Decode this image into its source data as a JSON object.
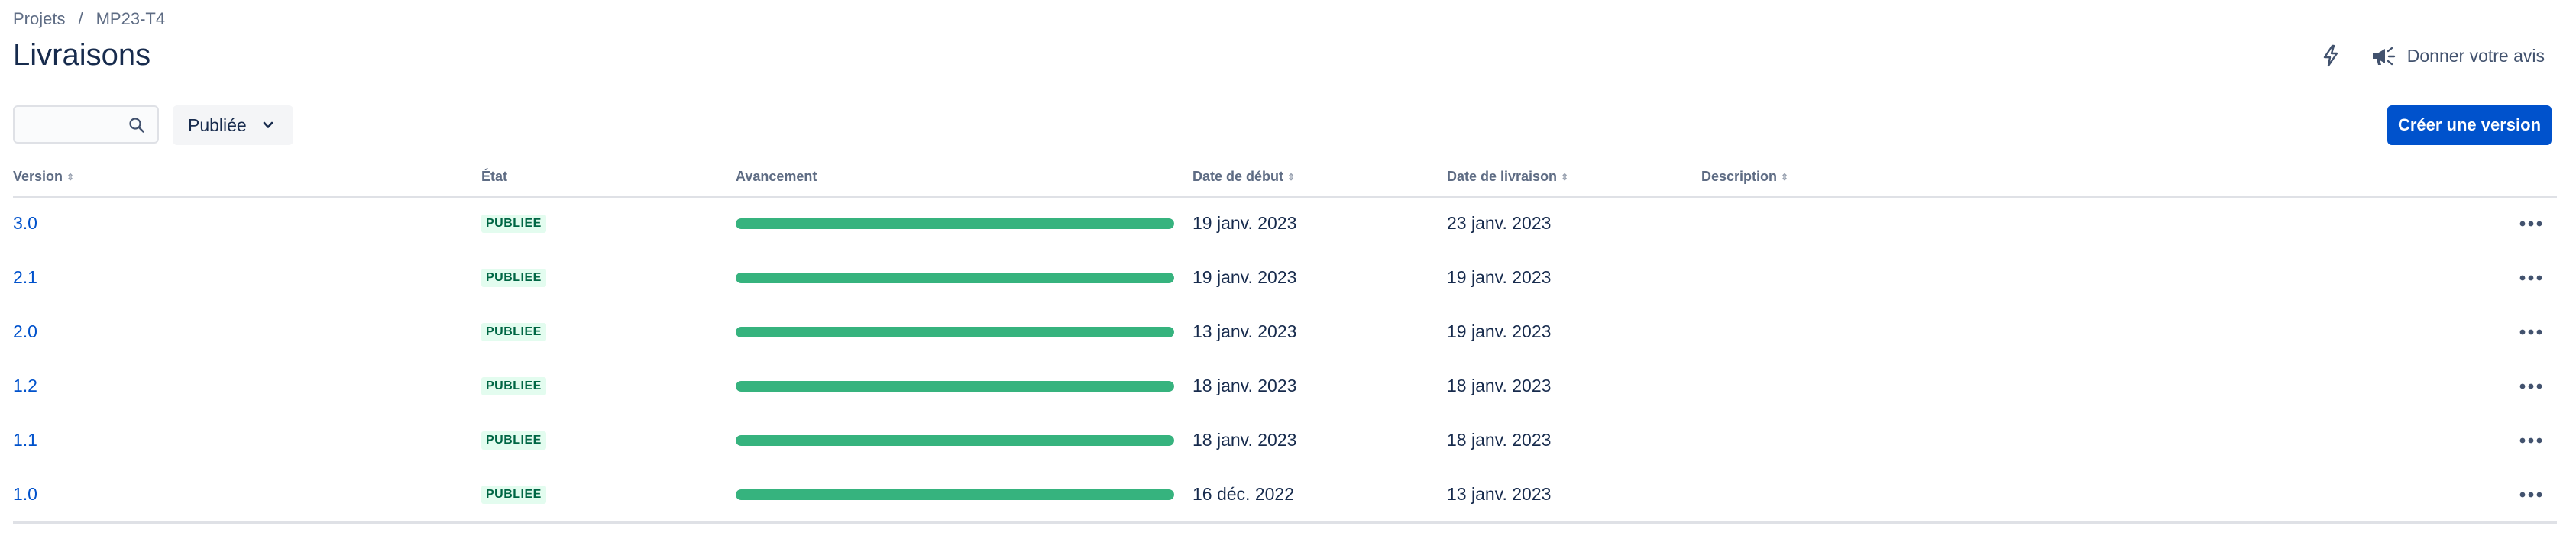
{
  "breadcrumb": {
    "items": [
      "Projets",
      "MP23-T4"
    ],
    "separator": "/"
  },
  "page": {
    "title": "Livraisons"
  },
  "actions": {
    "feedback_label": "Donner votre avis",
    "lightning_icon": "lightning-icon",
    "megaphone_icon": "megaphone-icon"
  },
  "filters": {
    "search_placeholder": "",
    "search_value": "",
    "status_selected": "Publiée"
  },
  "create_button_label": "Créer une version",
  "columns": {
    "version": "Version",
    "state": "État",
    "progress": "Avancement",
    "start_date": "Date de début",
    "release_date": "Date de livraison",
    "description": "Description"
  },
  "colors": {
    "accent": "#0052cc",
    "progress": "#36b37e",
    "badge_bg": "#e3fcef",
    "badge_text": "#006644"
  },
  "releases": [
    {
      "version": "3.0",
      "state": "PUBLIEE",
      "progress": 1.0,
      "start_date": "19 janv. 2023",
      "release_date": "23 janv. 2023",
      "description": ""
    },
    {
      "version": "2.1",
      "state": "PUBLIEE",
      "progress": 1.0,
      "start_date": "19 janv. 2023",
      "release_date": "19 janv. 2023",
      "description": ""
    },
    {
      "version": "2.0",
      "state": "PUBLIEE",
      "progress": 1.0,
      "start_date": "13 janv. 2023",
      "release_date": "19 janv. 2023",
      "description": ""
    },
    {
      "version": "1.2",
      "state": "PUBLIEE",
      "progress": 1.0,
      "start_date": "18 janv. 2023",
      "release_date": "18 janv. 2023",
      "description": ""
    },
    {
      "version": "1.1",
      "state": "PUBLIEE",
      "progress": 1.0,
      "start_date": "18 janv. 2023",
      "release_date": "18 janv. 2023",
      "description": ""
    },
    {
      "version": "1.0",
      "state": "PUBLIEE",
      "progress": 1.0,
      "start_date": "16 déc. 2022",
      "release_date": "13 janv. 2023",
      "description": ""
    }
  ]
}
